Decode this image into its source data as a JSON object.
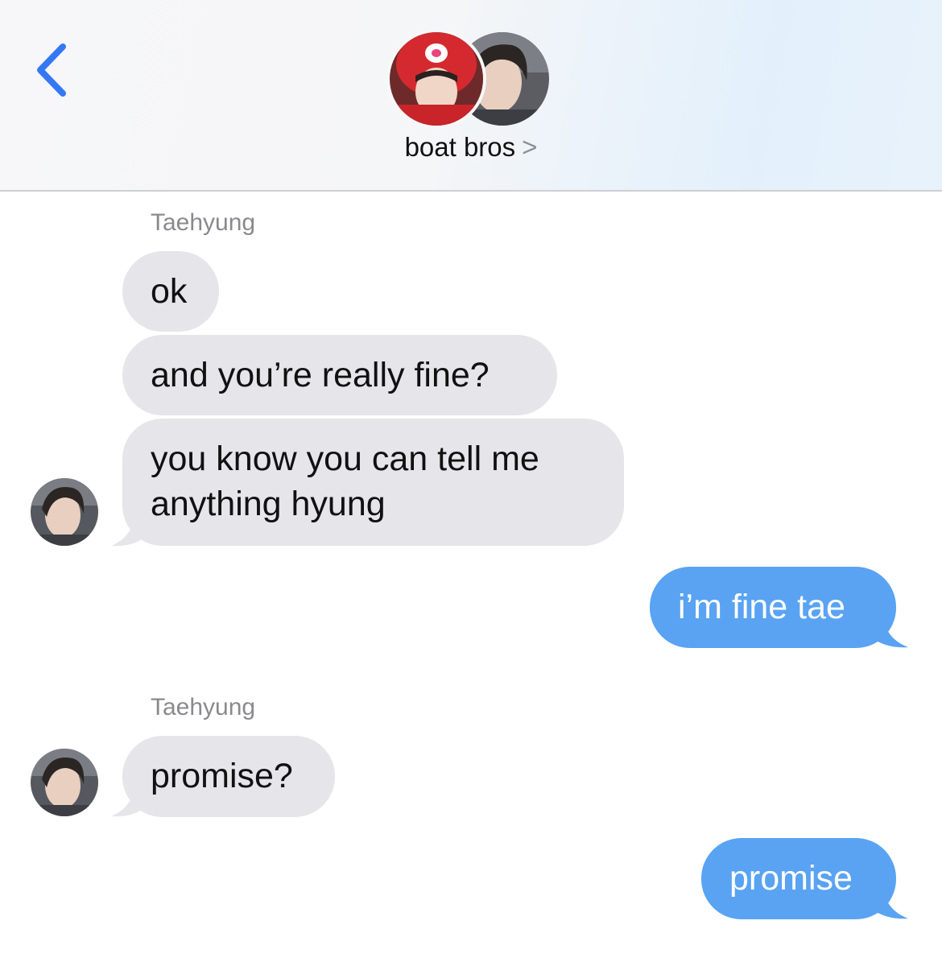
{
  "header": {
    "back_label": "",
    "title": "boat bros",
    "title_chevron": ">"
  },
  "colors": {
    "accent": "#3478f6",
    "incoming_bubble": "#e5e5ea",
    "outgoing_bubble": "#59a3f2"
  },
  "messages": [
    {
      "sender": "Taehyung",
      "text": "ok",
      "direction": "incoming"
    },
    {
      "text": "and you’re really fine?",
      "direction": "incoming"
    },
    {
      "text_lines": [
        "you know you can tell me",
        "anything hyung"
      ],
      "direction": "incoming"
    },
    {
      "text": "i’m fine tae",
      "direction": "outgoing"
    },
    {
      "sender": "Taehyung",
      "text": "promise?",
      "direction": "incoming"
    },
    {
      "text": "promise",
      "direction": "outgoing"
    }
  ]
}
